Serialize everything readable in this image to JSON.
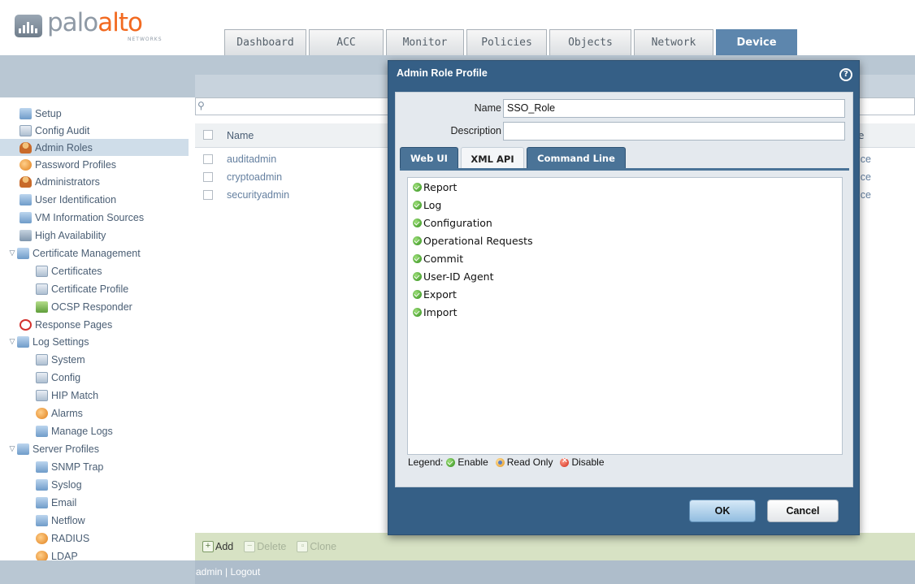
{
  "brand": {
    "logo_left": "palo",
    "logo_right": "alto",
    "logo_sub": "NETWORKS"
  },
  "tabs": [
    {
      "label": "Dashboard"
    },
    {
      "label": "ACC"
    },
    {
      "label": "Monitor"
    },
    {
      "label": "Policies"
    },
    {
      "label": "Objects"
    },
    {
      "label": "Network"
    },
    {
      "label": "Device",
      "active": true
    }
  ],
  "sidebar": {
    "items": [
      {
        "label": "Setup"
      },
      {
        "label": "Config Audit"
      },
      {
        "label": "Admin Roles",
        "selected": true
      },
      {
        "label": "Password Profiles"
      },
      {
        "label": "Administrators"
      },
      {
        "label": "User Identification"
      },
      {
        "label": "VM Information Sources"
      },
      {
        "label": "High Availability"
      },
      {
        "label": "Certificate Management",
        "expanded": true
      },
      {
        "label": "Certificates"
      },
      {
        "label": "Certificate Profile"
      },
      {
        "label": "OCSP Responder"
      },
      {
        "label": "Response Pages"
      },
      {
        "label": "Log Settings",
        "expanded": true
      },
      {
        "label": "System"
      },
      {
        "label": "Config"
      },
      {
        "label": "HIP Match"
      },
      {
        "label": "Alarms"
      },
      {
        "label": "Manage Logs"
      },
      {
        "label": "Server Profiles",
        "expanded": true
      },
      {
        "label": "SNMP Trap"
      },
      {
        "label": "Syslog"
      },
      {
        "label": "Email"
      },
      {
        "label": "Netflow"
      },
      {
        "label": "RADIUS"
      },
      {
        "label": "LDAP"
      }
    ]
  },
  "grid": {
    "header_name": "Name",
    "header_right": "e",
    "rows": [
      {
        "name": "auditadmin",
        "right": "ice"
      },
      {
        "name": "cryptoadmin",
        "right": "ice"
      },
      {
        "name": "securityadmin",
        "right": "ice"
      }
    ]
  },
  "toolbar": {
    "add": "Add",
    "delete": "Delete",
    "clone": "Clone"
  },
  "footer": {
    "user": "admin",
    "separator": " | ",
    "logout": "Logout"
  },
  "modal": {
    "title": "Admin Role Profile",
    "help_glyph": "?",
    "name_label": "Name",
    "name_value": "SSO_Role",
    "description_label": "Description",
    "description_value": "",
    "tabs": [
      {
        "label": "Web UI"
      },
      {
        "label": "XML API",
        "active": true
      },
      {
        "label": "Command Line"
      }
    ],
    "permissions": [
      {
        "label": "Report",
        "state": "enable"
      },
      {
        "label": "Log",
        "state": "enable"
      },
      {
        "label": "Configuration",
        "state": "enable"
      },
      {
        "label": "Operational Requests",
        "state": "enable"
      },
      {
        "label": "Commit",
        "state": "enable"
      },
      {
        "label": "User-ID Agent",
        "state": "enable"
      },
      {
        "label": "Export",
        "state": "enable"
      },
      {
        "label": "Import",
        "state": "enable"
      }
    ],
    "legend": {
      "title": "Legend:",
      "enable": "Enable",
      "read_only": "Read Only",
      "disable": "Disable"
    },
    "ok_label": "OK",
    "cancel_label": "Cancel"
  },
  "colors": {
    "accent": "#5d86ad",
    "modal_bg": "#355f86",
    "selected_row": "#cfdde9",
    "toolbar": "#d7e2c4",
    "brand_orange": "#f26a21"
  }
}
